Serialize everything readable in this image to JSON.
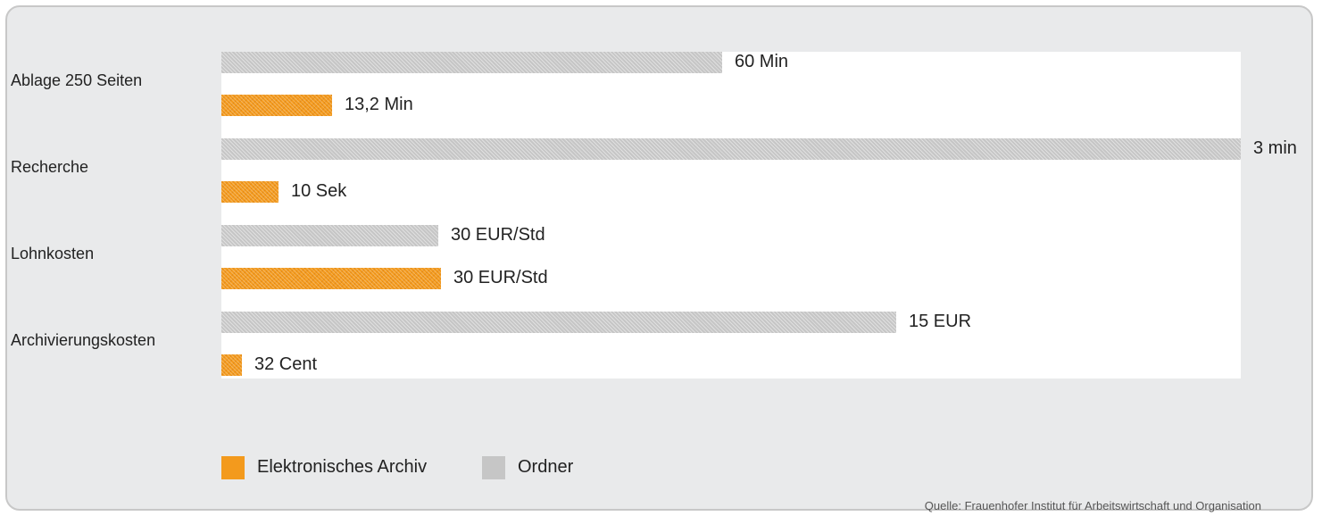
{
  "chart_data": {
    "type": "bar",
    "orientation": "horizontal",
    "categories": [
      "Ablage 250 Seiten",
      "Recherche",
      "Lohnkosten",
      "Archivierungskosten"
    ],
    "series": [
      {
        "name": "Ordner",
        "values": [
          60,
          180,
          30,
          15
        ],
        "labels": [
          "60 Min",
          "3 min",
          "30 EUR/Std",
          "15 EUR"
        ],
        "color": "#c6c6c6",
        "relative_length": [
          0.491,
          1.0,
          0.213,
          0.662
        ]
      },
      {
        "name": "Elektronisches Archiv",
        "values": [
          13.2,
          10,
          30,
          0.32
        ],
        "labels": [
          "13,2 Min",
          "10 Sek",
          "30 EUR/Std",
          "32 Cent"
        ],
        "color": "#f39a1d",
        "relative_length": [
          0.109,
          0.056,
          0.215,
          0.02
        ]
      }
    ],
    "legend": [
      {
        "label": "Elektronisches Archiv",
        "color": "#f39a1d"
      },
      {
        "label": "Ordner",
        "color": "#c6c6c6"
      }
    ],
    "legend_position": "bottom-left",
    "grid": false,
    "source": "Quelle: Frauenhofer Institut für Arbeitswirtschaft und Organisation"
  }
}
